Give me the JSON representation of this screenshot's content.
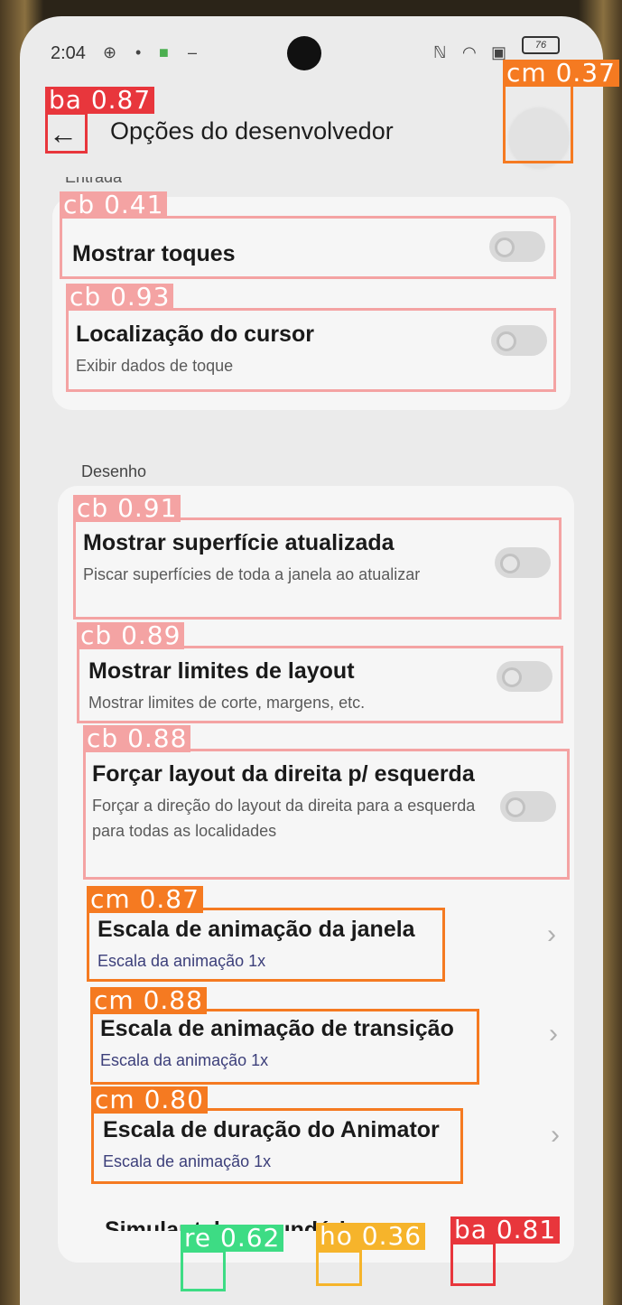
{
  "status_bar": {
    "time": "2:04",
    "battery": "76"
  },
  "header": {
    "title": "Opções do desenvolvedor",
    "back_icon": "←"
  },
  "sections": {
    "input_label_partial": "Entrada",
    "drawing_label": "Desenho"
  },
  "input_rows": [
    {
      "title": "Mostrar toques",
      "subtitle": "",
      "toggle": "off"
    },
    {
      "title": "Localização do cursor",
      "subtitle": "Exibir dados de toque",
      "toggle": "off"
    }
  ],
  "drawing_rows": [
    {
      "title": "Mostrar superfície atualizada",
      "subtitle": "Piscar superfícies de toda a janela ao atualizar",
      "toggle": "off"
    },
    {
      "title": "Mostrar limites de layout",
      "subtitle": "Mostrar limites de corte, margens, etc.",
      "toggle": "off"
    },
    {
      "title": "Forçar layout da direita p/ esquerda",
      "subtitle": "Forçar a direção do layout da direita para a esquerda para todas as localidades",
      "toggle": "off"
    }
  ],
  "animation_rows": [
    {
      "title": "Escala de animação da janela",
      "value": "Escala da animação 1x"
    },
    {
      "title": "Escala de animação de transição",
      "value": "Escala da animação 1x"
    },
    {
      "title": "Escala de duração do Animator",
      "value": "Escala de animação 1x"
    }
  ],
  "cut_off_row": "Simular tela secundária",
  "detections": [
    {
      "label": "ba 0.87",
      "color": "#e8363c"
    },
    {
      "label": "cm 0.37",
      "color": "#f57a21"
    },
    {
      "label": "cb 0.41",
      "color": "#f4a3a3"
    },
    {
      "label": "cb 0.93",
      "color": "#f4a3a3"
    },
    {
      "label": "cb 0.91",
      "color": "#f4a3a3"
    },
    {
      "label": "cb 0.89",
      "color": "#f4a3a3"
    },
    {
      "label": "cb 0.88",
      "color": "#f4a3a3"
    },
    {
      "label": "cm 0.87",
      "color": "#f57a21"
    },
    {
      "label": "cm 0.88",
      "color": "#f57a21"
    },
    {
      "label": "cm 0.80",
      "color": "#f57a21"
    },
    {
      "label": "re 0.62",
      "color": "#3ddc84"
    },
    {
      "label": "ho 0.36",
      "color": "#f6b42b"
    },
    {
      "label": "ba 0.81",
      "color": "#e8363c"
    }
  ]
}
